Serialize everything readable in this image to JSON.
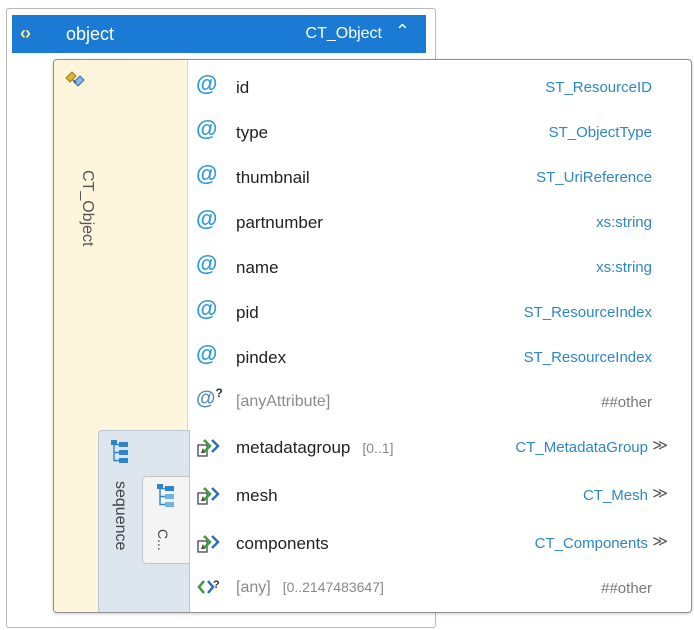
{
  "header": {
    "name": "object",
    "type": "CT_Object",
    "collapse_glyph": "≈",
    "icon": "element-icon"
  },
  "type_column": {
    "label": "CT_Object",
    "icon": "complex-type-icon"
  },
  "sequence": {
    "label": "sequence",
    "icon": "sequence-icon"
  },
  "choice": {
    "label": "C...",
    "icon": "choice-icon"
  },
  "attributes": [
    {
      "name": "id",
      "type": "ST_ResourceID"
    },
    {
      "name": "type",
      "type": "ST_ObjectType"
    },
    {
      "name": "thumbnail",
      "type": "ST_UriReference"
    },
    {
      "name": "partnumber",
      "type": "xs:string"
    },
    {
      "name": "name",
      "type": "xs:string"
    },
    {
      "name": "pid",
      "type": "ST_ResourceIndex"
    },
    {
      "name": "pindex",
      "type": "ST_ResourceIndex"
    }
  ],
  "any_attribute": {
    "name": "[anyAttribute]",
    "type": "##other"
  },
  "elements": [
    {
      "name": "metadatagroup",
      "cardinality": "[0..1]",
      "type": "CT_MetadataGroup",
      "expand": "≫"
    },
    {
      "name": "mesh",
      "cardinality": "",
      "type": "CT_Mesh",
      "expand": "≫"
    },
    {
      "name": "components",
      "cardinality": "",
      "type": "CT_Components",
      "expand": "≫"
    }
  ],
  "any_element": {
    "name": "[any]",
    "cardinality": "[0..2147483647]",
    "type": "##other"
  },
  "colors": {
    "header_bg": "#1a7ad4",
    "type_col_bg": "#fdf5dc",
    "attr_icon": "#2e9bd8",
    "type_text": "#2e86c9"
  }
}
